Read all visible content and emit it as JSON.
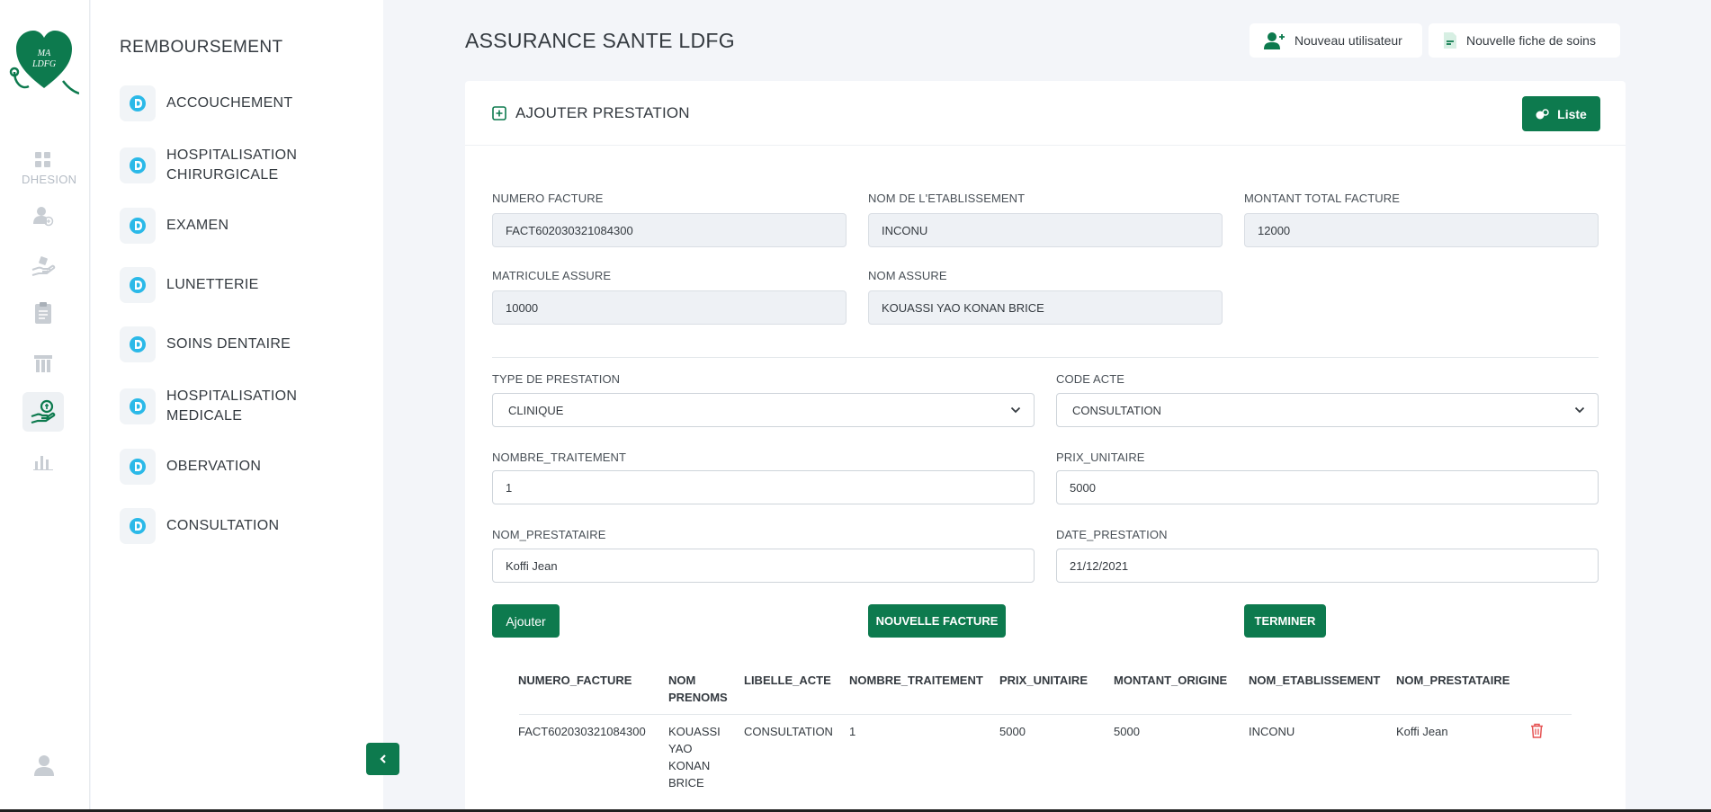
{
  "colors": {
    "accent": "#0d7a4e",
    "submenu_icon": "#2bb9e8",
    "danger": "#e55353"
  },
  "logo": {
    "text_line1": "MA",
    "text_line2": "LDFG"
  },
  "rail": {
    "label": "DHESION",
    "icons": [
      "dashboard-icon",
      "add-user-icon",
      "hand-care-icon",
      "clipboard-icon",
      "building-icon",
      "reimbursement-icon",
      "bar-chart-icon"
    ],
    "active_index": 5,
    "bottom_icon": "user-icon"
  },
  "submenu": {
    "title": "REMBOURSEMENT",
    "items": [
      {
        "label": "ACCOUCHEMENT"
      },
      {
        "label": "HOSPITALISATION\nCHIRURGICALE"
      },
      {
        "label": "EXAMEN"
      },
      {
        "label": "LUNETTERIE"
      },
      {
        "label": "SOINS DENTAIRE"
      },
      {
        "label": "HOSPITALISATION\nMEDICALE"
      },
      {
        "label": "OBERVATION"
      },
      {
        "label": "CONSULTATION"
      }
    ]
  },
  "header": {
    "title": "ASSURANCE SANTE LDFG",
    "new_user_label": "Nouveau utilisateur",
    "new_care_sheet_label": "Nouvelle fiche de soins"
  },
  "card": {
    "title": "AJOUTER PRESTATION",
    "list_button": "Liste"
  },
  "form": {
    "numero_facture": {
      "label": "NUMERO FACTURE",
      "value": "FACT602030321084300"
    },
    "nom_etablissement": {
      "label": "NOM DE L'ETABLISSEMENT",
      "value": "INCONU"
    },
    "montant_total": {
      "label": "MONTANT TOTAL FACTURE",
      "value": "12000"
    },
    "matricule": {
      "label": "MATRICULE ASSURE",
      "value": "10000"
    },
    "nom_assure": {
      "label": "NOM ASSURE",
      "value": "KOUASSI YAO KONAN BRICE"
    },
    "type_prestation": {
      "label": "TYPE DE PRESTATION",
      "value": "CLINIQUE"
    },
    "code_acte": {
      "label": "CODE ACTE",
      "value": "CONSULTATION"
    },
    "nombre_traitement": {
      "label": "NOMBRE_TRAITEMENT",
      "value": "1"
    },
    "prix_unitaire": {
      "label": "PRIX_UNITAIRE",
      "value": "5000"
    },
    "nom_prestataire": {
      "label": "NOM_PRESTATAIRE",
      "value": "Koffi Jean"
    },
    "date_prestation": {
      "label": "DATE_PRESTATION",
      "value": "21/12/2021"
    }
  },
  "actions": {
    "ajouter": "Ajouter",
    "nouvelle_facture": "NOUVELLE FACTURE",
    "terminer": "TERMINER"
  },
  "table": {
    "headers": [
      "NUMERO_FACTURE",
      "NOM\nPRENOMS",
      "LIBELLE_ACTE",
      "NOMBRE_TRAITEMENT",
      "PRIX_UNITAIRE",
      "MONTANT_ORIGINE",
      "NOM_ETABLISSEMENT",
      "NOM_PRESTATAIRE"
    ],
    "rows": [
      [
        "FACT602030321084300",
        "KOUASSI\nYAO\nKONAN\nBRICE",
        "CONSULTATION",
        "1",
        "5000",
        "5000",
        "INCONU",
        "Koffi Jean"
      ]
    ]
  }
}
